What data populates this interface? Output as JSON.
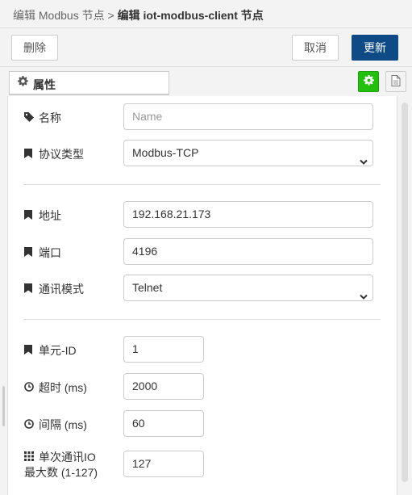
{
  "header": {
    "parent": "编辑 Modbus 节点",
    "separator": ">",
    "current": "编辑 iot-modbus-client 节点"
  },
  "toolbar": {
    "delete_label": "删除",
    "cancel_label": "取消",
    "update_label": "更新"
  },
  "tabs": {
    "properties_label": "属性"
  },
  "form": {
    "name": {
      "label": "名称",
      "placeholder": "Name",
      "value": ""
    },
    "protocol": {
      "label": "协议类型",
      "value": "Modbus-TCP"
    },
    "address": {
      "label": "地址",
      "value": "192.168.21.173"
    },
    "port": {
      "label": "端口",
      "value": "4196"
    },
    "comm_mode": {
      "label": "通讯模式",
      "value": "Telnet"
    },
    "unit_id": {
      "label": "单元-ID",
      "value": "1"
    },
    "timeout": {
      "label": "超时 (ms)",
      "value": "2000"
    },
    "interval": {
      "label": "间隔 (ms)",
      "value": "60"
    },
    "max_io_line1": "单次通讯IO",
    "max_io_line2": "最大数 (1-127)",
    "max_io_value": "127"
  },
  "icons": {
    "gear": "gear-icon",
    "doc": "document-icon",
    "tag": "tag-icon",
    "bookmark": "bookmark-icon",
    "clock": "clock-icon",
    "grid": "grid-icon"
  },
  "colors": {
    "update_button": "#0e4b86",
    "gear_button": "#22c00d"
  }
}
